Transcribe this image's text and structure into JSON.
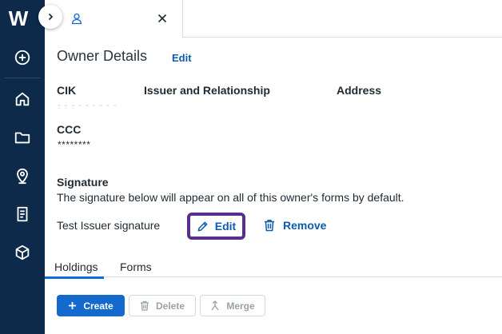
{
  "app": {
    "logo_text": "W",
    "rail_icons": [
      "add-circle-icon",
      "home-icon",
      "folder-icon",
      "location-pin-icon",
      "document-list-icon",
      "cube-icon"
    ]
  },
  "tab": {
    "icon": "user-icon",
    "close_icon": "close-icon"
  },
  "owner": {
    "title": "Owner Details",
    "edit_label": "Edit",
    "columns": [
      "CIK",
      "Issuer and Relationship",
      "Address"
    ],
    "ccc_label": "CCC",
    "ccc_value": "********"
  },
  "signature": {
    "label": "Signature",
    "description": "The signature below will appear on all of this owner's forms by default.",
    "name": "Test Issuer signature",
    "edit_label": "Edit",
    "remove_label": "Remove"
  },
  "subtabs": [
    {
      "label": "Holdings",
      "active": true
    },
    {
      "label": "Forms",
      "active": false
    }
  ],
  "actions": {
    "create_label": "Create",
    "delete_label": "Delete",
    "merge_label": "Merge"
  },
  "colors": {
    "rail": "#0d2a4a",
    "link": "#0b5cad",
    "primary": "#1469cc",
    "focus_outline": "#5a2e8c"
  }
}
